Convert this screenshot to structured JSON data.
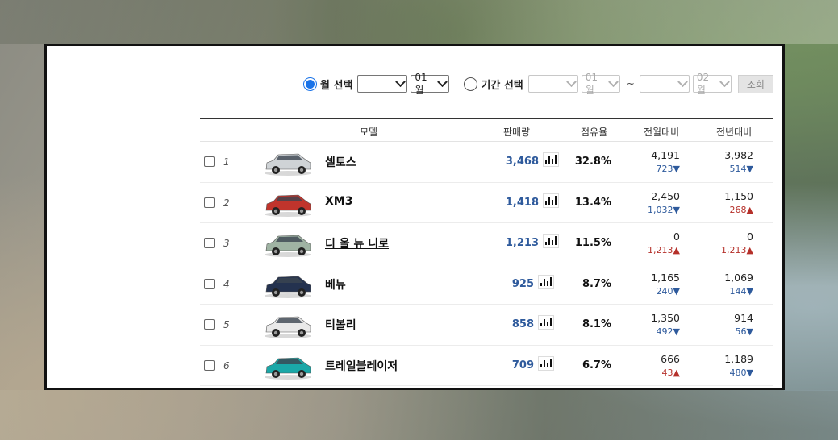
{
  "filter": {
    "month_label": "월 선택",
    "month_year_value": "",
    "month_value": "01월",
    "period_label": "기간 선택",
    "period_start_year": "",
    "period_start_month": "01월",
    "tilde": "~",
    "period_end_year": "",
    "period_end_month": "02월",
    "search_label": "조회"
  },
  "table": {
    "headers": {
      "model": "모델",
      "sales": "판매량",
      "share": "점유율",
      "mom": "전월대비",
      "yoy": "전년대비"
    },
    "rows": [
      {
        "rank": "1",
        "name": "셀토스",
        "sales": "3,468",
        "share": "32.8%",
        "mom_value": "4,191",
        "mom_diff": "723▼",
        "mom_dir": "down",
        "yoy_value": "3,982",
        "yoy_diff": "514▼",
        "yoy_dir": "down",
        "car_color": "#cfd3d6",
        "link": false
      },
      {
        "rank": "2",
        "name": "XM3",
        "sales": "1,418",
        "share": "13.4%",
        "mom_value": "2,450",
        "mom_diff": "1,032▼",
        "mom_dir": "down",
        "yoy_value": "1,150",
        "yoy_diff": "268▲",
        "yoy_dir": "up",
        "car_color": "#c0342c",
        "link": false
      },
      {
        "rank": "3",
        "name": "디 올 뉴 니로",
        "sales": "1,213",
        "share": "11.5%",
        "mom_value": "0",
        "mom_diff": "1,213▲",
        "mom_dir": "up",
        "yoy_value": "0",
        "yoy_diff": "1,213▲",
        "yoy_dir": "up",
        "car_color": "#9fb3a3",
        "link": true
      },
      {
        "rank": "4",
        "name": "베뉴",
        "sales": "925",
        "share": "8.7%",
        "mom_value": "1,165",
        "mom_diff": "240▼",
        "mom_dir": "down",
        "yoy_value": "1,069",
        "yoy_diff": "144▼",
        "yoy_dir": "down",
        "car_color": "#24324f",
        "link": false
      },
      {
        "rank": "5",
        "name": "티볼리",
        "sales": "858",
        "share": "8.1%",
        "mom_value": "1,350",
        "mom_diff": "492▼",
        "mom_dir": "down",
        "yoy_value": "914",
        "yoy_diff": "56▼",
        "yoy_dir": "down",
        "car_color": "#e9e9e9",
        "link": false
      },
      {
        "rank": "6",
        "name": "트레일블레이저",
        "sales": "709",
        "share": "6.7%",
        "mom_value": "666",
        "mom_diff": "43▲",
        "mom_dir": "up",
        "yoy_value": "1,189",
        "yoy_diff": "480▼",
        "yoy_dir": "down",
        "car_color": "#1aa8a8",
        "link": false
      }
    ]
  },
  "icons": {
    "chart": "bar-chart-icon",
    "dropdown": "chevron-down-icon"
  },
  "colors": {
    "down": "#2e5a9c",
    "up": "#b5302a",
    "radio_accent": "#1a73e8",
    "sales_text": "#2e5a9c"
  }
}
